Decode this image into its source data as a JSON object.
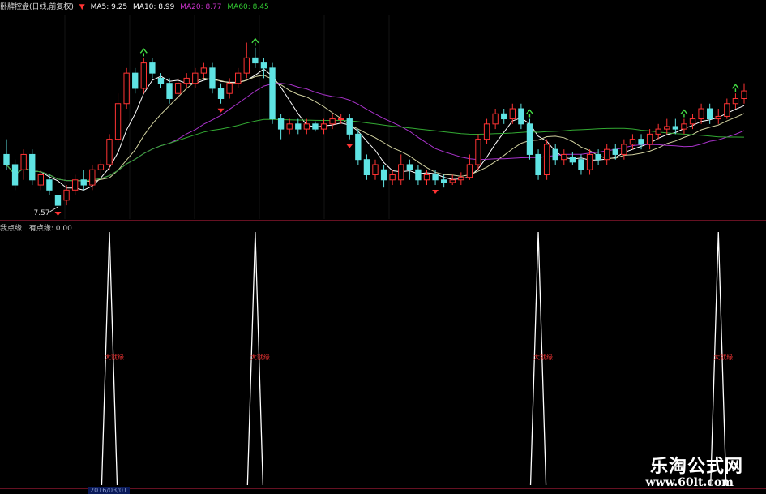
{
  "header": {
    "indicator_name": "卧牌控盘(日线,前复权)",
    "ma_labels": [
      {
        "text": "MA5: 9.25",
        "color": "#ffffff"
      },
      {
        "text": "MA10: 8.99",
        "color": "#ffffff"
      },
      {
        "text": "MA20: 8.77",
        "color": "#cc33cc"
      },
      {
        "text": "MA60: 8.45",
        "color": "#33cc33"
      }
    ]
  },
  "sub_panel": {
    "legend_left": "我点缘",
    "legend_right": "有点缘: 0.00",
    "spike_label": "大就缘"
  },
  "x_axis": {
    "date_tag": "2016/03/01"
  },
  "watermark": {
    "line1": "乐淘公式网",
    "line2": "www.60lt.com"
  },
  "colors": {
    "up": "#ff3333",
    "down": "#5fe3e3",
    "ma5": "#ffffff",
    "ma10": "#d2d2a0",
    "ma20": "#aa33cc",
    "ma60": "#33aa33",
    "sep": "#cc2244",
    "spike": "#ffffff"
  },
  "chart_data": {
    "type": "candlestick+indicator",
    "price_min": 7.57,
    "price_max": 11.0,
    "candles": [
      [
        8.6,
        8.4,
        8.9,
        8.3
      ],
      [
        8.4,
        8.0,
        8.5,
        7.9
      ],
      [
        8.3,
        8.6,
        8.7,
        8.1
      ],
      [
        8.6,
        8.1,
        8.7,
        8.0
      ],
      [
        8.0,
        8.2,
        8.3,
        7.9
      ],
      [
        8.1,
        7.9,
        8.2,
        7.8
      ],
      [
        7.8,
        7.6,
        7.95,
        7.57
      ],
      [
        7.7,
        7.9,
        8.0,
        7.6
      ],
      [
        7.9,
        8.1,
        8.2,
        7.8
      ],
      [
        8.1,
        8.0,
        8.3,
        7.9
      ],
      [
        8.0,
        8.3,
        8.4,
        7.9
      ],
      [
        8.3,
        8.4,
        8.5,
        8.2
      ],
      [
        8.4,
        8.9,
        9.0,
        8.3
      ],
      [
        8.9,
        9.6,
        9.8,
        8.8
      ],
      [
        9.6,
        10.2,
        10.3,
        9.5
      ],
      [
        10.2,
        9.9,
        10.3,
        9.8
      ],
      [
        9.9,
        10.4,
        10.5,
        9.8
      ],
      [
        10.4,
        10.2,
        10.5,
        10.1
      ],
      [
        10.1,
        10.0,
        10.2,
        9.9
      ],
      [
        10.0,
        9.7,
        10.1,
        9.6
      ],
      [
        9.8,
        10.0,
        10.1,
        9.7
      ],
      [
        10.0,
        10.1,
        10.2,
        9.9
      ],
      [
        10.0,
        10.2,
        10.3,
        9.9
      ],
      [
        10.2,
        10.3,
        10.4,
        10.1
      ],
      [
        10.3,
        9.9,
        10.4,
        9.8
      ],
      [
        9.9,
        9.7,
        10.0,
        9.6
      ],
      [
        9.8,
        10.0,
        10.1,
        9.7
      ],
      [
        10.0,
        10.2,
        10.3,
        9.9
      ],
      [
        10.2,
        10.5,
        10.8,
        10.1
      ],
      [
        10.5,
        10.4,
        10.7,
        10.3
      ],
      [
        10.4,
        10.3,
        10.5,
        10.1
      ],
      [
        10.3,
        9.3,
        10.4,
        9.2
      ],
      [
        9.3,
        9.1,
        9.4,
        8.9
      ],
      [
        9.1,
        9.2,
        9.3,
        9.0
      ],
      [
        9.2,
        9.1,
        9.3,
        9.0
      ],
      [
        9.1,
        9.2,
        9.3,
        9.0
      ],
      [
        9.2,
        9.1,
        9.25,
        9.05
      ],
      [
        9.1,
        9.2,
        9.3,
        9.0
      ],
      [
        9.2,
        9.3,
        9.4,
        9.1
      ],
      [
        9.3,
        9.3,
        9.4,
        9.2
      ],
      [
        9.3,
        9.0,
        9.4,
        8.9
      ],
      [
        9.0,
        8.5,
        9.1,
        8.4
      ],
      [
        8.5,
        8.2,
        8.6,
        8.1
      ],
      [
        8.2,
        8.4,
        8.5,
        8.1
      ],
      [
        8.3,
        8.1,
        8.4,
        7.95
      ],
      [
        8.1,
        8.2,
        8.3,
        8.0
      ],
      [
        8.1,
        8.4,
        8.6,
        8.0
      ],
      [
        8.4,
        8.3,
        8.5,
        8.1
      ],
      [
        8.3,
        8.1,
        8.4,
        8.0
      ],
      [
        8.1,
        8.2,
        8.3,
        8.0
      ],
      [
        8.2,
        8.1,
        8.3,
        8.0
      ],
      [
        8.1,
        8.05,
        8.2,
        7.95
      ],
      [
        8.05,
        8.1,
        8.2,
        8.0
      ],
      [
        8.1,
        8.15,
        8.25,
        8.0
      ],
      [
        8.15,
        8.4,
        8.6,
        8.1
      ],
      [
        8.4,
        8.9,
        9.0,
        8.3
      ],
      [
        8.9,
        9.2,
        9.3,
        8.8
      ],
      [
        9.2,
        9.4,
        9.5,
        9.1
      ],
      [
        9.4,
        9.3,
        9.5,
        9.2
      ],
      [
        9.3,
        9.5,
        9.6,
        9.2
      ],
      [
        9.5,
        9.2,
        9.6,
        9.1
      ],
      [
        9.2,
        8.6,
        9.3,
        8.5
      ],
      [
        8.6,
        8.2,
        8.7,
        8.1
      ],
      [
        8.2,
        8.8,
        8.9,
        8.1
      ],
      [
        8.7,
        8.5,
        8.8,
        8.4
      ],
      [
        8.5,
        8.6,
        8.7,
        8.4
      ],
      [
        8.55,
        8.45,
        8.65,
        8.4
      ],
      [
        8.5,
        8.3,
        8.6,
        8.2
      ],
      [
        8.3,
        8.6,
        8.7,
        8.2
      ],
      [
        8.6,
        8.5,
        8.7,
        8.4
      ],
      [
        8.5,
        8.7,
        8.8,
        8.4
      ],
      [
        8.7,
        8.6,
        8.8,
        8.5
      ],
      [
        8.6,
        8.8,
        8.9,
        8.5
      ],
      [
        8.8,
        8.9,
        9.0,
        8.7
      ],
      [
        8.9,
        8.8,
        9.0,
        8.7
      ],
      [
        8.8,
        9.0,
        9.1,
        8.7
      ],
      [
        9.0,
        9.1,
        9.2,
        8.9
      ],
      [
        9.1,
        9.15,
        9.3,
        9.0
      ],
      [
        9.15,
        9.1,
        9.3,
        9.0
      ],
      [
        9.1,
        9.2,
        9.3,
        9.0
      ],
      [
        9.2,
        9.3,
        9.4,
        9.1
      ],
      [
        9.3,
        9.5,
        9.6,
        9.2
      ],
      [
        9.5,
        9.3,
        9.6,
        9.2
      ],
      [
        9.3,
        9.35,
        9.5,
        9.2
      ],
      [
        9.35,
        9.6,
        9.7,
        9.3
      ],
      [
        9.6,
        9.7,
        9.8,
        9.5
      ],
      [
        9.7,
        9.85,
        10.0,
        9.6
      ]
    ],
    "low_label": "7.57",
    "spike_positions": [
      12,
      29,
      62,
      83
    ]
  }
}
